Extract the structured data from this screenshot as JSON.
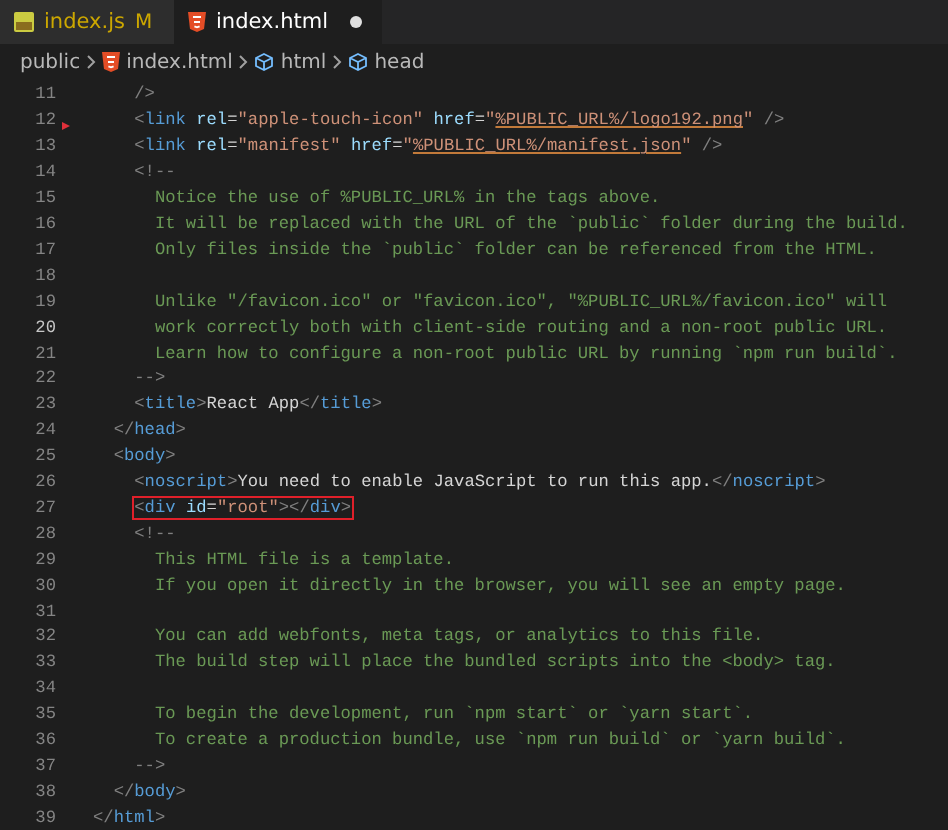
{
  "tabs": [
    {
      "label": "index.js",
      "status": "M",
      "unsaved": false,
      "selected": false
    },
    {
      "label": "index.html",
      "unsaved": true,
      "selected": true
    }
  ],
  "breadcrumb": [
    {
      "label": "public"
    },
    {
      "label": "index.html"
    },
    {
      "label": "html"
    },
    {
      "label": "head"
    }
  ],
  "lines": [
    {
      "children": [
        {
          "children": [
            {
              "number": "11",
              "selected": false,
              "marker": false,
              "boxed": false,
              "tokens": [
                {
                  "kind": "punct",
                  "text": "/>"
                }
              ]
            },
            {
              "number": "12",
              "selected": false,
              "marker": true,
              "boxed": false,
              "tokens": [
                {
                  "kind": "punct",
                  "text": "<"
                },
                {
                  "kind": "tag",
                  "text": "link"
                },
                {
                  "kind": "attr",
                  "text": " rel"
                },
                {
                  "kind": "text",
                  "text": "="
                },
                {
                  "kind": "string",
                  "text": "\"apple-touch-icon\""
                },
                {
                  "kind": "attr",
                  "text": " href"
                },
                {
                  "kind": "text",
                  "text": "="
                },
                {
                  "kind": "string",
                  "text": "\""
                },
                {
                  "kind": "url",
                  "text": "%PUBLIC_URL%/logo192.png"
                },
                {
                  "kind": "string",
                  "text": "\""
                },
                {
                  "kind": "punct",
                  "text": " />"
                }
              ]
            },
            {
              "number": "13",
              "selected": false,
              "marker": false,
              "boxed": false,
              "tokens": [
                {
                  "kind": "punct",
                  "text": "<"
                },
                {
                  "kind": "tag",
                  "text": "link"
                },
                {
                  "kind": "attr",
                  "text": " rel"
                },
                {
                  "kind": "text",
                  "text": "="
                },
                {
                  "kind": "string",
                  "text": "\"manifest\""
                },
                {
                  "kind": "attr",
                  "text": " href"
                },
                {
                  "kind": "text",
                  "text": "="
                },
                {
                  "kind": "string",
                  "text": "\""
                },
                {
                  "kind": "url",
                  "text": "%PUBLIC_URL%/manifest.json"
                },
                {
                  "kind": "string",
                  "text": "\""
                },
                {
                  "kind": "punct",
                  "text": " />"
                }
              ]
            },
            {
              "number": "14",
              "selected": false,
              "marker": false,
              "boxed": false,
              "tokens": [
                {
                  "kind": "punct",
                  "text": "<!--"
                }
              ],
              "children": [
                {
                  "number": "15",
                  "selected": false,
                  "marker": false,
                  "boxed": false,
                  "tokens": [
                    {
                      "kind": "comment",
                      "text": "Notice the use of %PUBLIC_URL% in the tags above."
                    }
                  ]
                },
                {
                  "number": "16",
                  "selected": false,
                  "marker": false,
                  "boxed": false,
                  "tokens": [
                    {
                      "kind": "comment",
                      "text": "It will be replaced with the URL of the `public` folder during the build."
                    }
                  ]
                },
                {
                  "number": "17",
                  "selected": false,
                  "marker": false,
                  "boxed": false,
                  "tokens": [
                    {
                      "kind": "comment",
                      "text": "Only files inside the `public` folder can be referenced from the HTML."
                    }
                  ]
                },
                {
                  "number": "18",
                  "selected": false,
                  "marker": false
                },
                {
                  "number": "19",
                  "selected": false,
                  "marker": false,
                  "boxed": false,
                  "tokens": [
                    {
                      "kind": "comment",
                      "text": "Unlike \"/favicon.ico\" or \"favicon.ico\", \"%PUBLIC_URL%/favicon.ico\" will"
                    }
                  ]
                },
                {
                  "number": "20",
                  "selected": true,
                  "marker": false,
                  "boxed": false,
                  "tokens": [
                    {
                      "kind": "comment",
                      "text": "work correctly both with client-side routing and a non-root public URL."
                    }
                  ]
                },
                {
                  "number": "21",
                  "selected": false,
                  "marker": false,
                  "boxed": false,
                  "tokens": [
                    {
                      "kind": "comment",
                      "text": "Learn how to configure a non-root public URL by running `npm run build`."
                    }
                  ]
                }
              ]
            },
            {
              "number": "22",
              "selected": false,
              "marker": false,
              "boxed": false,
              "tokens": [
                {
                  "kind": "punct",
                  "text": "-->"
                }
              ]
            },
            {
              "number": "23",
              "selected": false,
              "marker": false,
              "boxed": false,
              "tokens": [
                {
                  "kind": "punct",
                  "text": "<"
                },
                {
                  "kind": "tag",
                  "text": "title"
                },
                {
                  "kind": "punct",
                  "text": ">"
                },
                {
                  "kind": "text",
                  "text": "React App"
                },
                {
                  "kind": "punct",
                  "text": "</"
                },
                {
                  "kind": "tag",
                  "text": "title"
                },
                {
                  "kind": "punct",
                  "text": ">"
                }
              ]
            }
          ]
        },
        {
          "number": "24",
          "selected": false,
          "marker": false,
          "boxed": false,
          "tokens": [
            {
              "kind": "punct",
              "text": "</"
            },
            {
              "kind": "tag",
              "text": "head"
            },
            {
              "kind": "punct",
              "text": ">"
            }
          ]
        },
        {
          "number": "25",
          "selected": false,
          "marker": false,
          "boxed": false,
          "tokens": [
            {
              "kind": "punct",
              "text": "<"
            },
            {
              "kind": "tag",
              "text": "body"
            },
            {
              "kind": "punct",
              "text": ">"
            }
          ],
          "children": [
            {
              "number": "26",
              "selected": false,
              "marker": false,
              "boxed": false,
              "tokens": [
                {
                  "kind": "punct",
                  "text": "<"
                },
                {
                  "kind": "tag",
                  "text": "noscript"
                },
                {
                  "kind": "punct",
                  "text": ">"
                },
                {
                  "kind": "text",
                  "text": "You need to enable JavaScript to run this app."
                },
                {
                  "kind": "punct",
                  "text": "</"
                },
                {
                  "kind": "tag",
                  "text": "noscript"
                },
                {
                  "kind": "punct",
                  "text": ">"
                }
              ]
            },
            {
              "number": "27",
              "selected": false,
              "marker": false,
              "boxed": true,
              "tokens": [
                {
                  "kind": "punct",
                  "text": "<"
                },
                {
                  "kind": "tag",
                  "text": "div"
                },
                {
                  "kind": "attr",
                  "text": " id"
                },
                {
                  "kind": "text",
                  "text": "="
                },
                {
                  "kind": "string",
                  "text": "\"root\""
                },
                {
                  "kind": "punct",
                  "text": "></"
                },
                {
                  "kind": "tag",
                  "text": "div"
                },
                {
                  "kind": "punct",
                  "text": ">"
                }
              ]
            },
            {
              "number": "28",
              "selected": false,
              "marker": false,
              "boxed": false,
              "tokens": [
                {
                  "kind": "punct",
                  "text": "<!--"
                }
              ],
              "children": [
                {
                  "number": "29",
                  "selected": false,
                  "marker": false,
                  "boxed": false,
                  "tokens": [
                    {
                      "kind": "comment",
                      "text": "This HTML file is a template."
                    }
                  ]
                },
                {
                  "number": "30",
                  "selected": false,
                  "marker": false,
                  "boxed": false,
                  "tokens": [
                    {
                      "kind": "comment",
                      "text": "If you open it directly in the browser, you will see an empty page."
                    }
                  ]
                },
                {
                  "number": "31",
                  "selected": false,
                  "marker": false
                },
                {
                  "number": "32",
                  "selected": false,
                  "marker": false,
                  "boxed": false,
                  "tokens": [
                    {
                      "kind": "comment",
                      "text": "You can add webfonts, meta tags, or analytics to this file."
                    }
                  ]
                },
                {
                  "number": "33",
                  "selected": false,
                  "marker": false,
                  "boxed": false,
                  "tokens": [
                    {
                      "kind": "comment",
                      "text": "The build step will place the bundled scripts into the <body> tag."
                    }
                  ]
                },
                {
                  "number": "34",
                  "selected": false,
                  "marker": false
                },
                {
                  "number": "35",
                  "selected": false,
                  "marker": false,
                  "boxed": false,
                  "tokens": [
                    {
                      "kind": "comment",
                      "text": "To begin the development, run `npm start` or `yarn start`."
                    }
                  ]
                },
                {
                  "number": "36",
                  "selected": false,
                  "marker": false,
                  "boxed": false,
                  "tokens": [
                    {
                      "kind": "comment",
                      "text": "To create a production bundle, use `npm run build` or `yarn build`."
                    }
                  ]
                }
              ]
            },
            {
              "number": "37",
              "selected": false,
              "marker": false,
              "boxed": false,
              "tokens": [
                {
                  "kind": "punct",
                  "text": "-->"
                }
              ]
            }
          ]
        },
        {
          "number": "38",
          "selected": false,
          "marker": false,
          "boxed": false,
          "tokens": [
            {
              "kind": "punct",
              "text": "</"
            },
            {
              "kind": "tag",
              "text": "body"
            },
            {
              "kind": "punct",
              "text": ">"
            }
          ]
        }
      ]
    },
    {
      "number": "39",
      "selected": false,
      "marker": false,
      "boxed": false,
      "tokens": [
        {
          "kind": "punct",
          "text": "</"
        },
        {
          "kind": "tag",
          "text": "html"
        },
        {
          "kind": "punct",
          "text": ">"
        }
      ]
    }
  ]
}
